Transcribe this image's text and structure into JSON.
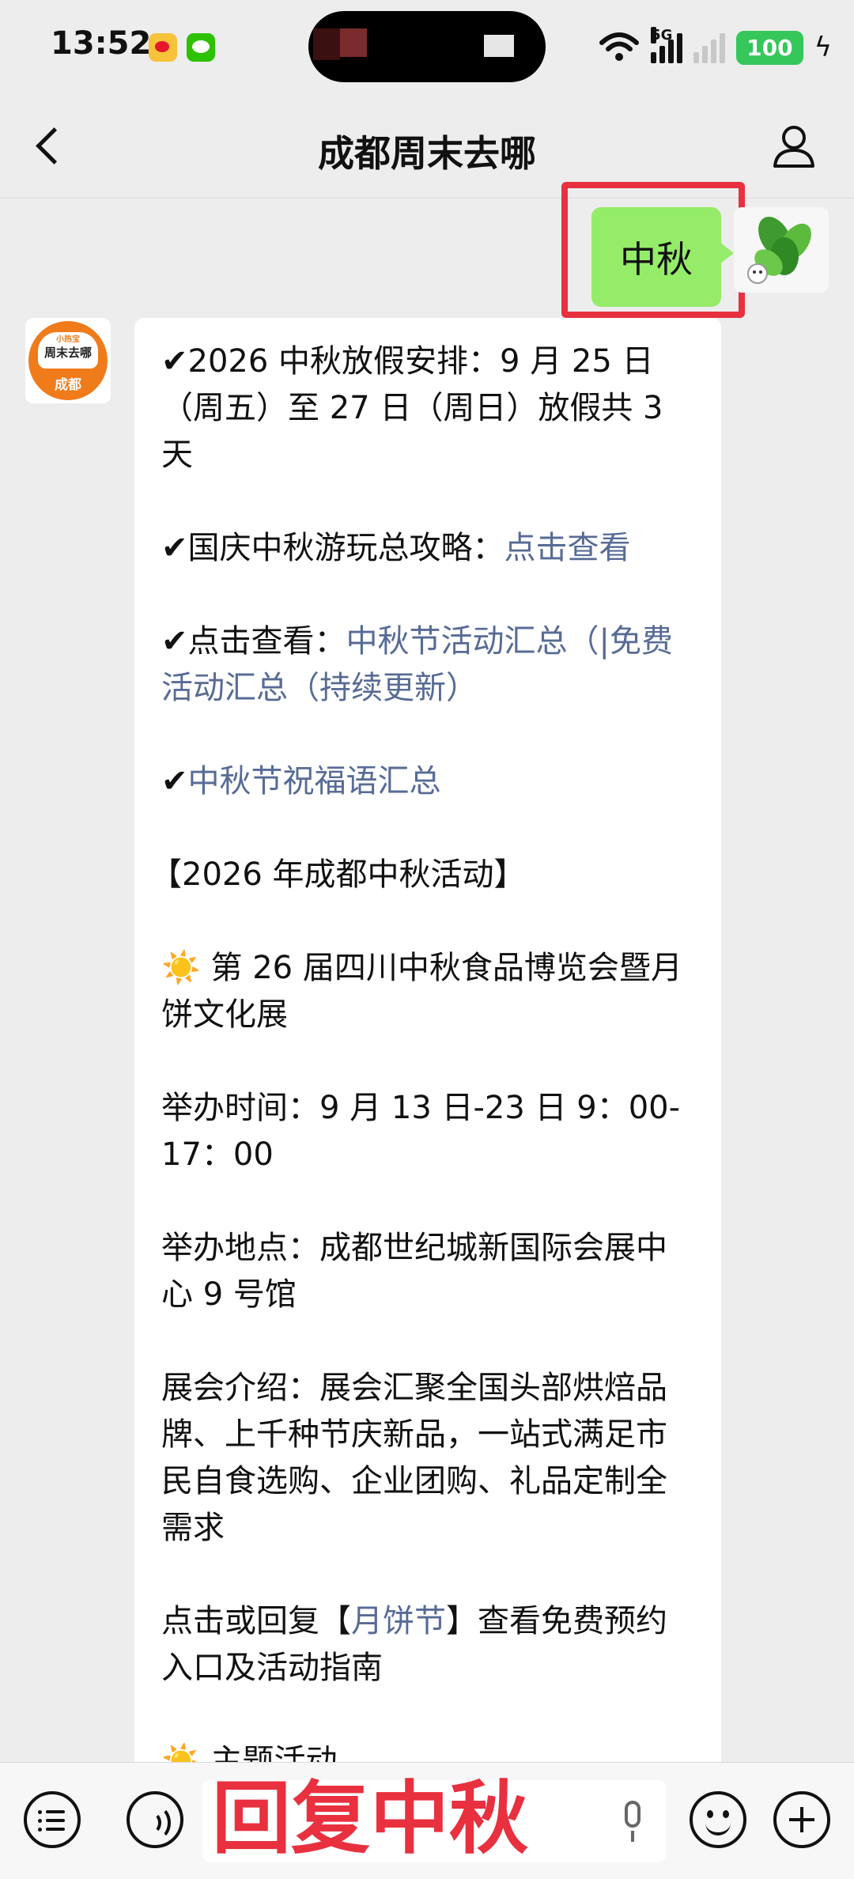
{
  "status_bar": {
    "time": "13:52",
    "network": "5G",
    "battery": "100",
    "icons": [
      "weibo-icon",
      "wechat-icon",
      "wifi-icon",
      "signal-icon",
      "charging-icon"
    ]
  },
  "header": {
    "title": "成都周末去哪",
    "back_icon": "chevron-left-icon",
    "profile_icon": "person-icon"
  },
  "outgoing_message": {
    "text": "中秋"
  },
  "oa_avatar": {
    "top_text": "小热宝",
    "middle_text": "周末去哪",
    "bottom_text": "成都",
    "brand_color": "#f07b1b"
  },
  "incoming_message": {
    "line1": "✔2026 中秋放假安排：9 月 25 日（周五）至 27 日（周日）放假共 3 天",
    "line2_prefix": "✔国庆中秋游玩总攻略：",
    "line2_link": "点击查看",
    "line3_prefix": "✔点击查看：",
    "line3_link": "中秋节活动汇总（|免费活动汇总（持续更新）",
    "line4_prefix": "✔",
    "line4_link": "中秋节祝福语汇总",
    "section_title": "【2026 年成都中秋活动】",
    "event_title": "☀️ 第 26 届四川中秋食品博览会暨月饼文化展",
    "event_time": "举办时间：9 月 13 日-23 日 9：00-17：00",
    "event_place": "举办地点：成都世纪城新国际会展中心 9 号馆",
    "event_intro": "展会介绍：展会汇聚全国头部烘焙品牌、上千种节庆新品，一站式满足市民自食选购、企业团购、礼品定制全需求",
    "reply_prefix": "点击或回复【",
    "reply_link": "月饼节",
    "reply_suffix": "】查看免费预约入口及活动指南",
    "cut_off": "☀️ 主题活动"
  },
  "input_bar": {
    "hint": "回复中秋",
    "menu_icon": "list-menu-icon",
    "voice_icon": "voice-icon",
    "mic_icon": "microphone-icon",
    "emoji_icon": "emoji-icon",
    "plus_icon": "plus-icon"
  },
  "colors": {
    "bubble_out": "#95ec69",
    "link": "#576b95",
    "highlight": "#e8303f",
    "background": "#ededed"
  }
}
